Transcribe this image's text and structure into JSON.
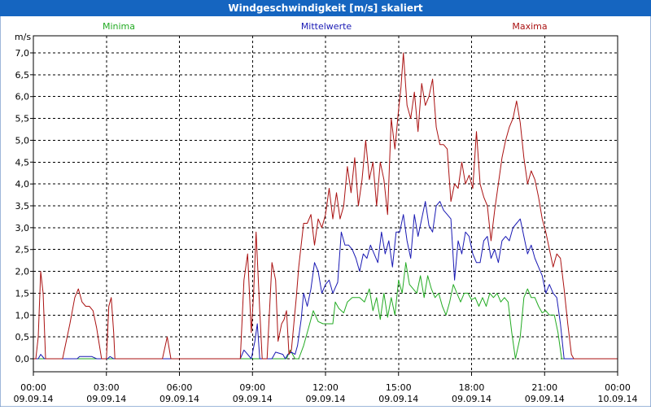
{
  "window": {
    "title": "Windgeschwindigkeit [m/s] skaliert",
    "title_bg": "#1565c0",
    "title_color": "#ffffff"
  },
  "chart_data": {
    "type": "line",
    "title": "Windgeschwindigkeit [m/s] skaliert",
    "ylabel": "m/s",
    "xlabel": "",
    "ylim": [
      0,
      7.5
    ],
    "xlim": [
      0,
      24
    ],
    "grid": true,
    "legend_position": "top",
    "y_ticks": [
      "0,0",
      "0,5",
      "1,0",
      "1,5",
      "2,0",
      "2,5",
      "3,0",
      "3,5",
      "4,0",
      "4,5",
      "5,0",
      "5,5",
      "6,0",
      "6,5",
      "7,0"
    ],
    "x_ticks": [
      {
        "time": "00:00",
        "date": "09.09.14"
      },
      {
        "time": "03:00",
        "date": "09.09.14"
      },
      {
        "time": "06:00",
        "date": "09.09.14"
      },
      {
        "time": "09:00",
        "date": "09.09.14"
      },
      {
        "time": "12:00",
        "date": "09.09.14"
      },
      {
        "time": "15:00",
        "date": "09.09.14"
      },
      {
        "time": "18:00",
        "date": "09.09.14"
      },
      {
        "time": "21:00",
        "date": "09.09.14"
      },
      {
        "time": "00:00",
        "date": "10.09.14"
      }
    ],
    "series": [
      {
        "name": "Minima",
        "color": "#22aa22",
        "points": [
          [
            0,
            0
          ],
          [
            10.4,
            0
          ],
          [
            10.55,
            0.2
          ],
          [
            10.75,
            0
          ],
          [
            10.9,
            0
          ],
          [
            11.1,
            0.3
          ],
          [
            11.3,
            0.7
          ],
          [
            11.5,
            1.1
          ],
          [
            11.7,
            0.85
          ],
          [
            11.9,
            0.8
          ],
          [
            12.3,
            0.8
          ],
          [
            12.4,
            1.3
          ],
          [
            12.55,
            1.15
          ],
          [
            12.75,
            1.05
          ],
          [
            12.9,
            1.3
          ],
          [
            13.1,
            1.4
          ],
          [
            13.25,
            1.4
          ],
          [
            13.4,
            1.4
          ],
          [
            13.6,
            1.3
          ],
          [
            13.8,
            1.6
          ],
          [
            13.95,
            1.1
          ],
          [
            14.1,
            1.4
          ],
          [
            14.25,
            0.9
          ],
          [
            14.4,
            1.5
          ],
          [
            14.55,
            0.95
          ],
          [
            14.7,
            1.4
          ],
          [
            14.85,
            1.0
          ],
          [
            15.0,
            1.8
          ],
          [
            15.15,
            1.5
          ],
          [
            15.3,
            2.2
          ],
          [
            15.45,
            1.7
          ],
          [
            15.6,
            1.6
          ],
          [
            15.75,
            1.5
          ],
          [
            15.9,
            1.9
          ],
          [
            16.05,
            1.4
          ],
          [
            16.2,
            1.9
          ],
          [
            16.35,
            1.6
          ],
          [
            16.5,
            1.4
          ],
          [
            16.65,
            1.5
          ],
          [
            16.8,
            1.2
          ],
          [
            16.95,
            1.0
          ],
          [
            17.1,
            1.3
          ],
          [
            17.25,
            1.7
          ],
          [
            17.4,
            1.5
          ],
          [
            17.55,
            1.3
          ],
          [
            17.7,
            1.5
          ],
          [
            17.85,
            1.5
          ],
          [
            18.0,
            1.35
          ],
          [
            18.15,
            1.4
          ],
          [
            18.3,
            1.2
          ],
          [
            18.45,
            1.4
          ],
          [
            18.6,
            1.2
          ],
          [
            18.75,
            1.5
          ],
          [
            18.9,
            1.4
          ],
          [
            19.05,
            1.5
          ],
          [
            19.2,
            1.3
          ],
          [
            19.35,
            1.4
          ],
          [
            19.5,
            1.3
          ],
          [
            19.65,
            0.6
          ],
          [
            19.8,
            0.0
          ],
          [
            20.0,
            0.5
          ],
          [
            20.15,
            1.4
          ],
          [
            20.3,
            1.6
          ],
          [
            20.45,
            1.4
          ],
          [
            20.6,
            1.4
          ],
          [
            20.75,
            1.2
          ],
          [
            20.9,
            1.05
          ],
          [
            21.05,
            1.1
          ],
          [
            21.2,
            1.0
          ],
          [
            21.4,
            1.0
          ],
          [
            21.55,
            0.6
          ],
          [
            21.7,
            0.0
          ],
          [
            24,
            0
          ]
        ]
      },
      {
        "name": "Mittelwerte",
        "color": "#1a1ab4",
        "points": [
          [
            0,
            0
          ],
          [
            0.2,
            0
          ],
          [
            0.3,
            0.1
          ],
          [
            0.45,
            0
          ],
          [
            1.8,
            0
          ],
          [
            1.9,
            0.05
          ],
          [
            2.4,
            0.05
          ],
          [
            2.6,
            0
          ],
          [
            3.05,
            0
          ],
          [
            3.15,
            0.05
          ],
          [
            3.3,
            0
          ],
          [
            8.0,
            0
          ],
          [
            8.5,
            0
          ],
          [
            8.65,
            0.2
          ],
          [
            8.8,
            0.1
          ],
          [
            8.95,
            0.0
          ],
          [
            9.1,
            0.4
          ],
          [
            9.2,
            0.8
          ],
          [
            9.3,
            0.0
          ],
          [
            9.6,
            0
          ],
          [
            9.8,
            0
          ],
          [
            9.95,
            0.15
          ],
          [
            10.25,
            0.1
          ],
          [
            10.35,
            0.0
          ],
          [
            10.45,
            0.1
          ],
          [
            10.6,
            0.15
          ],
          [
            10.75,
            0.1
          ],
          [
            10.85,
            0.3
          ],
          [
            11.0,
            0.9
          ],
          [
            11.1,
            1.5
          ],
          [
            11.25,
            1.2
          ],
          [
            11.4,
            1.6
          ],
          [
            11.55,
            2.2
          ],
          [
            11.7,
            2.0
          ],
          [
            11.85,
            1.5
          ],
          [
            12.0,
            1.7
          ],
          [
            12.15,
            1.8
          ],
          [
            12.3,
            1.5
          ],
          [
            12.5,
            1.75
          ],
          [
            12.65,
            2.9
          ],
          [
            12.8,
            2.6
          ],
          [
            12.95,
            2.6
          ],
          [
            13.1,
            2.5
          ],
          [
            13.25,
            2.3
          ],
          [
            13.4,
            2.0
          ],
          [
            13.55,
            2.4
          ],
          [
            13.7,
            2.3
          ],
          [
            13.85,
            2.6
          ],
          [
            14.0,
            2.4
          ],
          [
            14.15,
            2.2
          ],
          [
            14.3,
            2.9
          ],
          [
            14.45,
            2.4
          ],
          [
            14.6,
            2.7
          ],
          [
            14.75,
            2.1
          ],
          [
            14.9,
            2.9
          ],
          [
            15.05,
            2.9
          ],
          [
            15.2,
            3.3
          ],
          [
            15.35,
            2.7
          ],
          [
            15.5,
            2.3
          ],
          [
            15.65,
            3.3
          ],
          [
            15.8,
            2.8
          ],
          [
            15.95,
            3.2
          ],
          [
            16.1,
            3.6
          ],
          [
            16.25,
            3.05
          ],
          [
            16.4,
            2.9
          ],
          [
            16.55,
            3.5
          ],
          [
            16.7,
            3.6
          ],
          [
            16.85,
            3.4
          ],
          [
            17.0,
            3.3
          ],
          [
            17.15,
            3.2
          ],
          [
            17.3,
            1.8
          ],
          [
            17.45,
            2.7
          ],
          [
            17.6,
            2.4
          ],
          [
            17.75,
            2.9
          ],
          [
            17.9,
            2.8
          ],
          [
            18.05,
            2.4
          ],
          [
            18.2,
            2.2
          ],
          [
            18.35,
            2.2
          ],
          [
            18.5,
            2.7
          ],
          [
            18.65,
            2.8
          ],
          [
            18.8,
            2.3
          ],
          [
            18.95,
            2.5
          ],
          [
            19.1,
            2.2
          ],
          [
            19.25,
            2.7
          ],
          [
            19.4,
            2.8
          ],
          [
            19.55,
            2.7
          ],
          [
            19.7,
            3.0
          ],
          [
            19.85,
            3.1
          ],
          [
            20.0,
            3.2
          ],
          [
            20.15,
            2.8
          ],
          [
            20.3,
            2.4
          ],
          [
            20.45,
            2.6
          ],
          [
            20.6,
            2.3
          ],
          [
            20.75,
            2.1
          ],
          [
            20.9,
            1.9
          ],
          [
            21.05,
            1.5
          ],
          [
            21.2,
            1.7
          ],
          [
            21.35,
            1.5
          ],
          [
            21.5,
            1.4
          ],
          [
            21.65,
            0.8
          ],
          [
            21.8,
            0.0
          ],
          [
            24,
            0
          ]
        ]
      },
      {
        "name": "Maxima",
        "color": "#aa1111",
        "points": [
          [
            0,
            0
          ],
          [
            0.1,
            0
          ],
          [
            0.2,
            0.5
          ],
          [
            0.3,
            2.0
          ],
          [
            0.4,
            1.5
          ],
          [
            0.5,
            0
          ],
          [
            1.2,
            0
          ],
          [
            1.5,
            0.8
          ],
          [
            1.7,
            1.4
          ],
          [
            1.85,
            1.6
          ],
          [
            2.0,
            1.3
          ],
          [
            2.15,
            1.2
          ],
          [
            2.3,
            1.2
          ],
          [
            2.45,
            1.1
          ],
          [
            2.6,
            0.7
          ],
          [
            2.8,
            0.0
          ],
          [
            3.0,
            0
          ],
          [
            3.1,
            1.2
          ],
          [
            3.2,
            1.4
          ],
          [
            3.3,
            0.6
          ],
          [
            3.35,
            0.0
          ],
          [
            5.3,
            0
          ],
          [
            5.5,
            0.5
          ],
          [
            5.65,
            0
          ],
          [
            8.5,
            0
          ],
          [
            8.65,
            1.8
          ],
          [
            8.8,
            2.4
          ],
          [
            8.95,
            0.6
          ],
          [
            9.05,
            1.5
          ],
          [
            9.15,
            2.9
          ],
          [
            9.3,
            1.1
          ],
          [
            9.4,
            0.0
          ],
          [
            9.6,
            0
          ],
          [
            9.7,
            1.1
          ],
          [
            9.8,
            2.2
          ],
          [
            9.95,
            1.8
          ],
          [
            10.05,
            0.4
          ],
          [
            10.2,
            0.8
          ],
          [
            10.3,
            0.9
          ],
          [
            10.4,
            1.1
          ],
          [
            10.5,
            0.1
          ],
          [
            10.6,
            0.2
          ],
          [
            10.7,
            0.8
          ],
          [
            10.8,
            1.4
          ],
          [
            10.9,
            2.1
          ],
          [
            11.0,
            2.6
          ],
          [
            11.1,
            3.1
          ],
          [
            11.25,
            3.1
          ],
          [
            11.4,
            3.3
          ],
          [
            11.55,
            2.6
          ],
          [
            11.7,
            3.2
          ],
          [
            11.85,
            3.0
          ],
          [
            12.0,
            3.3
          ],
          [
            12.15,
            3.9
          ],
          [
            12.3,
            3.2
          ],
          [
            12.45,
            3.8
          ],
          [
            12.6,
            3.2
          ],
          [
            12.75,
            3.5
          ],
          [
            12.9,
            4.4
          ],
          [
            13.05,
            3.8
          ],
          [
            13.2,
            4.6
          ],
          [
            13.35,
            3.5
          ],
          [
            13.5,
            4.1
          ],
          [
            13.65,
            5.0
          ],
          [
            13.8,
            4.1
          ],
          [
            13.95,
            4.5
          ],
          [
            14.1,
            3.5
          ],
          [
            14.25,
            4.5
          ],
          [
            14.4,
            4.1
          ],
          [
            14.55,
            3.3
          ],
          [
            14.7,
            5.5
          ],
          [
            14.85,
            4.8
          ],
          [
            15.0,
            5.7
          ],
          [
            15.1,
            6.2
          ],
          [
            15.2,
            7.0
          ],
          [
            15.35,
            5.8
          ],
          [
            15.5,
            5.5
          ],
          [
            15.65,
            6.1
          ],
          [
            15.8,
            5.2
          ],
          [
            15.95,
            6.3
          ],
          [
            16.1,
            5.8
          ],
          [
            16.25,
            6.0
          ],
          [
            16.4,
            6.4
          ],
          [
            16.55,
            5.3
          ],
          [
            16.7,
            4.9
          ],
          [
            16.85,
            4.9
          ],
          [
            17.0,
            4.8
          ],
          [
            17.15,
            3.6
          ],
          [
            17.3,
            4.0
          ],
          [
            17.45,
            3.9
          ],
          [
            17.6,
            4.5
          ],
          [
            17.75,
            4.0
          ],
          [
            17.9,
            4.2
          ],
          [
            18.05,
            3.9
          ],
          [
            18.2,
            5.2
          ],
          [
            18.35,
            4.0
          ],
          [
            18.5,
            3.7
          ],
          [
            18.65,
            3.5
          ],
          [
            18.8,
            2.7
          ],
          [
            18.95,
            3.4
          ],
          [
            19.1,
            4.0
          ],
          [
            19.25,
            4.6
          ],
          [
            19.4,
            5.0
          ],
          [
            19.55,
            5.3
          ],
          [
            19.7,
            5.5
          ],
          [
            19.85,
            5.9
          ],
          [
            20.0,
            5.4
          ],
          [
            20.15,
            4.6
          ],
          [
            20.3,
            4.0
          ],
          [
            20.45,
            4.3
          ],
          [
            20.6,
            4.1
          ],
          [
            20.75,
            3.7
          ],
          [
            20.9,
            3.2
          ],
          [
            21.05,
            2.9
          ],
          [
            21.2,
            2.5
          ],
          [
            21.35,
            2.1
          ],
          [
            21.5,
            2.4
          ],
          [
            21.65,
            2.3
          ],
          [
            21.8,
            1.6
          ],
          [
            21.95,
            0.8
          ],
          [
            22.1,
            0.1
          ],
          [
            22.2,
            0.0
          ],
          [
            24,
            0
          ]
        ]
      }
    ]
  }
}
